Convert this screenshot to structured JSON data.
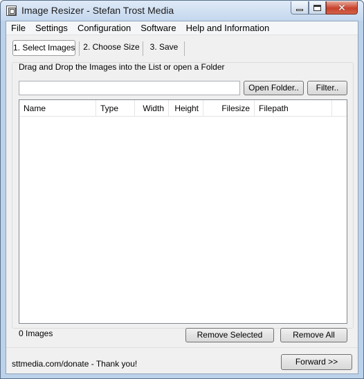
{
  "window": {
    "title": "Image Resizer - Stefan Trost Media",
    "icon": "app-window-icon",
    "controls": [
      "minimize",
      "maximize",
      "close"
    ],
    "close_glyph": "✕"
  },
  "menu": {
    "items": [
      "File",
      "Settings",
      "Configuration",
      "Software",
      "Help and Information"
    ]
  },
  "steps": {
    "tabs": [
      "1. Select Images",
      "2. Choose Size",
      "3. Save"
    ],
    "active_index": 0
  },
  "select": {
    "instruction": "Drag and Drop the Images into the List or open a Folder",
    "path_value": "",
    "open_folder_label": "Open Folder..",
    "filter_label": "Filter.."
  },
  "list": {
    "columns": [
      "Name",
      "Type",
      "Width",
      "Height",
      "Filesize",
      "Filepath"
    ],
    "rows": []
  },
  "status": {
    "count_text": "0 Images",
    "remove_selected_label": "Remove Selected",
    "remove_all_label": "Remove All"
  },
  "footer": {
    "donate_text": "sttmedia.com/donate - Thank you!",
    "forward_label": "Forward >>"
  }
}
